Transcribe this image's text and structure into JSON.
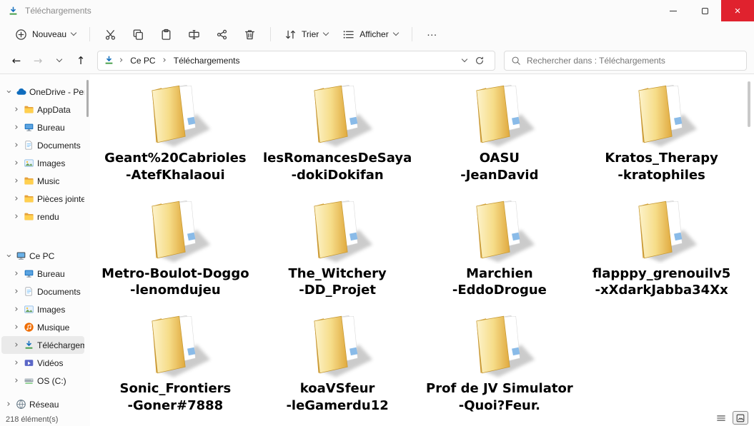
{
  "window": {
    "title": "Téléchargements"
  },
  "icons": {
    "back": "←",
    "forward": "→",
    "up": "↑",
    "breadcrumb_sep": "›",
    "chevron": "›",
    "close": "×"
  },
  "toolbar": {
    "new": {
      "label": "Nouveau"
    },
    "actions": [
      {
        "icon": "cut",
        "name": "cut-button"
      },
      {
        "icon": "copy",
        "name": "copy-button"
      },
      {
        "icon": "paste",
        "name": "paste-button"
      },
      {
        "icon": "rename",
        "name": "rename-button"
      },
      {
        "icon": "share",
        "name": "share-button"
      },
      {
        "icon": "delete",
        "name": "delete-button"
      }
    ],
    "sort_label": "Trier",
    "view_label": "Afficher",
    "more_label": "…"
  },
  "navbar": {
    "breadcrumb": {
      "root": "Ce PC",
      "current": "Téléchargements"
    },
    "search_placeholder": "Rechercher dans : Téléchargements"
  },
  "sidebar": {
    "items": [
      {
        "label": "OneDrive - Perso",
        "icon": "cloud",
        "chevron": "expanded",
        "indent": 0
      },
      {
        "label": "AppData",
        "icon": "folder",
        "chevron": "collapsed",
        "indent": 1
      },
      {
        "label": "Bureau",
        "icon": "desktop",
        "chevron": "collapsed",
        "indent": 1
      },
      {
        "label": "Documents",
        "icon": "document",
        "chevron": "collapsed",
        "indent": 1
      },
      {
        "label": "Images",
        "icon": "picture",
        "chevron": "collapsed",
        "indent": 1
      },
      {
        "label": "Music",
        "icon": "folder",
        "chevron": "collapsed",
        "indent": 1
      },
      {
        "label": "Pièces jointes",
        "icon": "folder",
        "chevron": "collapsed",
        "indent": 1
      },
      {
        "label": "rendu",
        "icon": "folder",
        "chevron": "collapsed",
        "indent": 1,
        "gap_after": 30
      },
      {
        "label": "Ce PC",
        "icon": "pc",
        "chevron": "expanded",
        "indent": 0
      },
      {
        "label": "Bureau",
        "icon": "desktop",
        "chevron": "collapsed",
        "indent": 1
      },
      {
        "label": "Documents",
        "icon": "document",
        "chevron": "collapsed",
        "indent": 1
      },
      {
        "label": "Images",
        "icon": "picture",
        "chevron": "collapsed",
        "indent": 1
      },
      {
        "label": "Musique",
        "icon": "music",
        "chevron": "collapsed",
        "indent": 1
      },
      {
        "label": "Téléchargements",
        "icon": "download",
        "chevron": "collapsed",
        "indent": 1,
        "selected": true
      },
      {
        "label": "Vidéos",
        "icon": "video",
        "chevron": "collapsed",
        "indent": 1
      },
      {
        "label": "OS (C:)",
        "icon": "disk",
        "chevron": "collapsed",
        "indent": 1,
        "gap_after": 8
      },
      {
        "label": "Réseau",
        "icon": "globe",
        "chevron": "collapsed",
        "indent": 0
      }
    ]
  },
  "content": {
    "folders": [
      {
        "name_line1": "Geant%20Cabrioles",
        "name_line2": "-AtefKhalaoui"
      },
      {
        "name_line1": "lesRomancesDeSaya",
        "name_line2": "-dokiDokifan"
      },
      {
        "name_line1": "OASU",
        "name_line2": "-JeanDavid"
      },
      {
        "name_line1": "Kratos_Therapy",
        "name_line2": "-kratophiles"
      },
      {
        "name_line1": "Metro-Boulot-Doggo",
        "name_line2": "-lenomdujeu"
      },
      {
        "name_line1": "The_Witchery",
        "name_line2": "-DD_Projet"
      },
      {
        "name_line1": "Marchien",
        "name_line2": "-EddoDrogue"
      },
      {
        "name_line1": "flapppy_grenouilv5",
        "name_line2": "-xXdarkJabba34Xx"
      },
      {
        "name_line1": "Sonic_Frontiers",
        "name_line2": "-Goner#7888"
      },
      {
        "name_line1": "koaVSfeur",
        "name_line2": "-leGamerdu12"
      },
      {
        "name_line1": "Prof de JV Simulator",
        "name_line2": "-Quoi?Feur."
      }
    ]
  },
  "statusbar": {
    "count": "218 élément(s)",
    "view_toggles": [
      {
        "icon": "listview",
        "name": "list-view-button"
      },
      {
        "icon": "thumbview",
        "name": "large-view-button",
        "active": true
      }
    ]
  }
}
